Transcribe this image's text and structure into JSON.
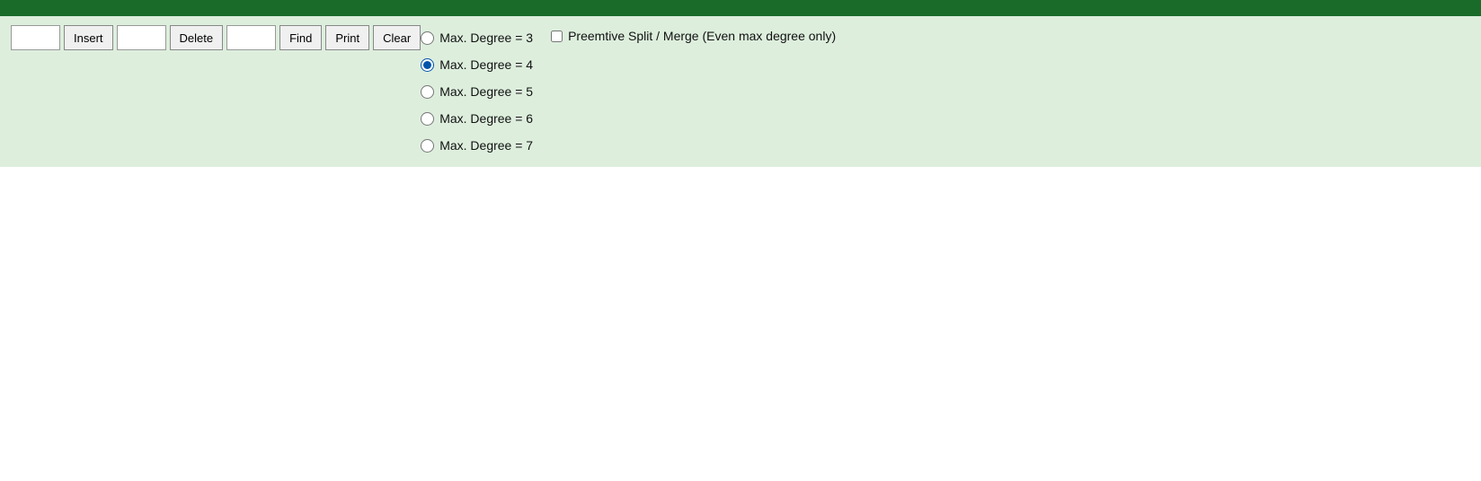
{
  "header": {
    "bg": "#1a6b2a"
  },
  "toolbar": {
    "insert_label": "Insert",
    "delete_label": "Delete",
    "find_label": "Find",
    "print_label": "Print",
    "clear_label": "Clear",
    "insert_placeholder": "",
    "delete_placeholder": "",
    "find_placeholder": ""
  },
  "degrees": [
    {
      "value": "3",
      "label": "Max. Degree = 3",
      "checked": false
    },
    {
      "value": "4",
      "label": "Max. Degree = 4",
      "checked": true
    },
    {
      "value": "5",
      "label": "Max. Degree = 5",
      "checked": false
    },
    {
      "value": "6",
      "label": "Max. Degree = 6",
      "checked": false
    },
    {
      "value": "7",
      "label": "Max. Degree = 7",
      "checked": false
    }
  ],
  "preemptive": {
    "label": "Preemtive Split / Merge (Even max degree only)",
    "checked": false
  }
}
